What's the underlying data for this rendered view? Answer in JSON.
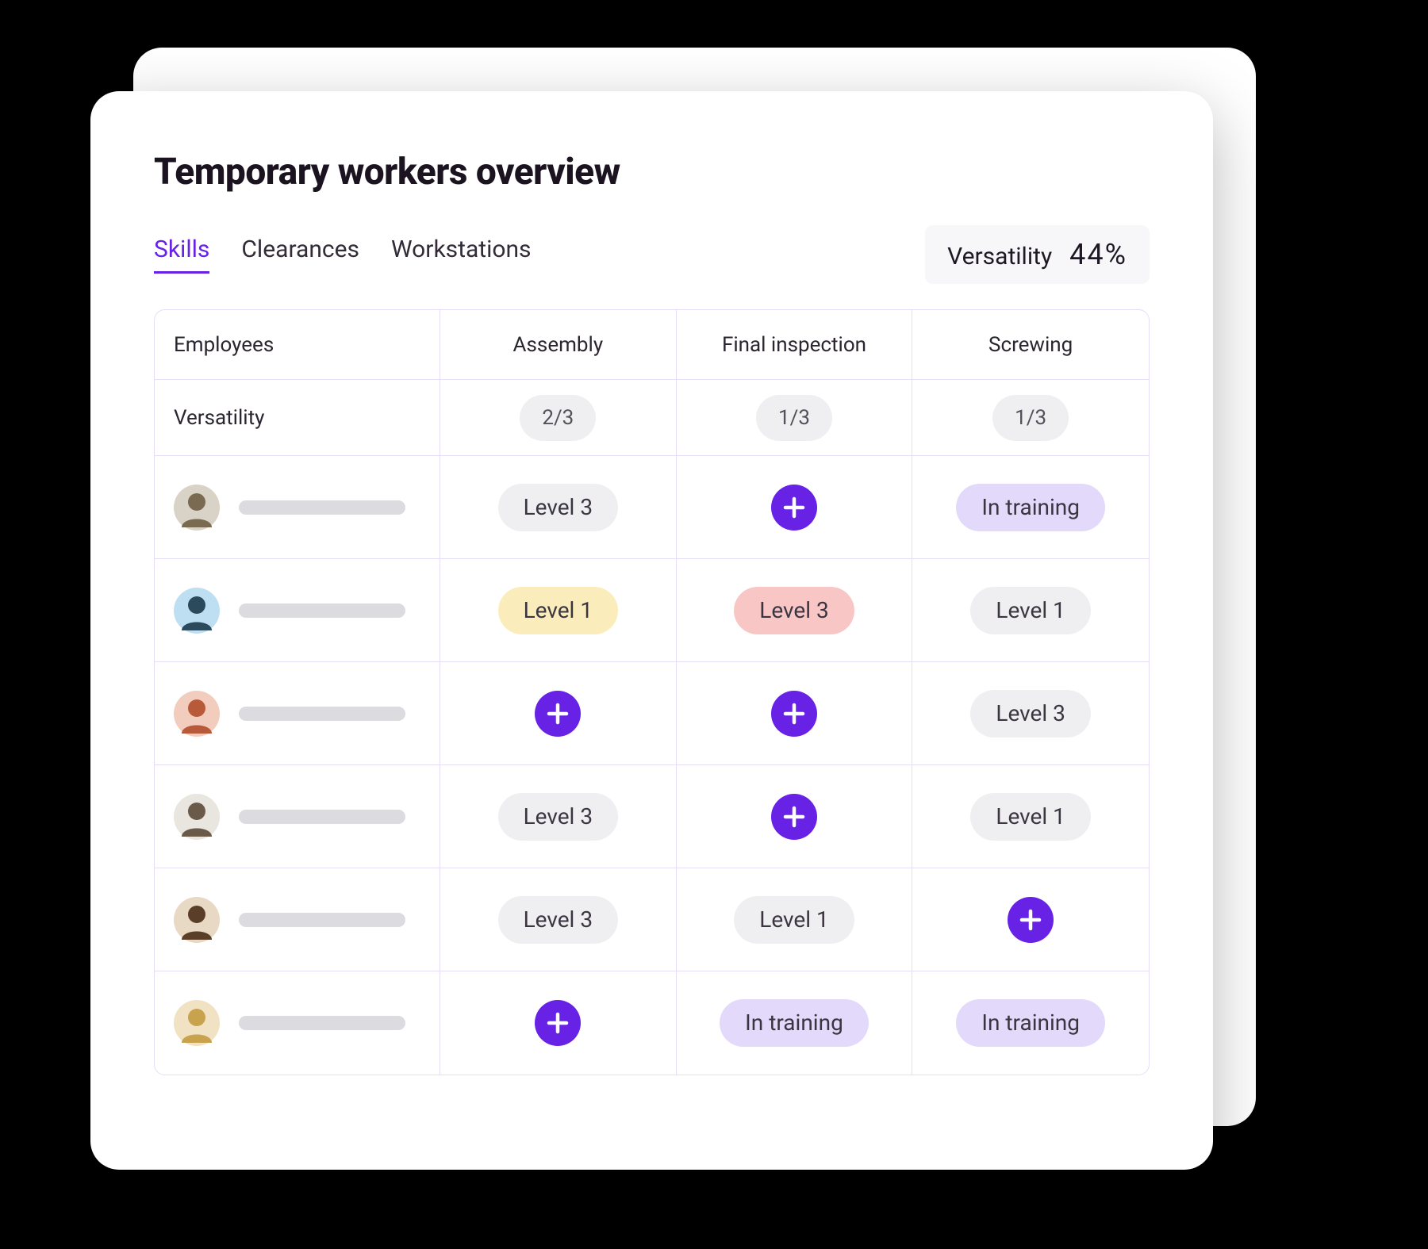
{
  "title": "Temporary workers overview",
  "tabs": [
    "Skills",
    "Clearances",
    "Workstations"
  ],
  "active_tab": 0,
  "versatility": {
    "label": "Versatility",
    "value": "44%"
  },
  "columns": [
    "Employees",
    "Assembly",
    "Final inspection",
    "Screwing"
  ],
  "versatility_row": {
    "label": "Versatility",
    "counts": [
      "2/3",
      "1/3",
      "1/3"
    ]
  },
  "avatar_colors": [
    {
      "bg": "#d9d2c6",
      "fg": "#7a6a52"
    },
    {
      "bg": "#bedff2",
      "fg": "#2b4b5c"
    },
    {
      "bg": "#f2cdbd",
      "fg": "#b85a3a"
    },
    {
      "bg": "#e9e5df",
      "fg": "#6a5a4a"
    },
    {
      "bg": "#e8d9c5",
      "fg": "#5a3e28"
    },
    {
      "bg": "#f1e2c3",
      "fg": "#c9a24e"
    }
  ],
  "rows": [
    {
      "cells": [
        {
          "type": "pill",
          "text": "Level 3",
          "variant": "gray"
        },
        {
          "type": "plus"
        },
        {
          "type": "pill",
          "text": "In training",
          "variant": "lavender"
        }
      ]
    },
    {
      "cells": [
        {
          "type": "pill",
          "text": "Level 1",
          "variant": "yellow"
        },
        {
          "type": "pill",
          "text": "Level 3",
          "variant": "red"
        },
        {
          "type": "pill",
          "text": "Level 1",
          "variant": "gray"
        }
      ]
    },
    {
      "cells": [
        {
          "type": "plus"
        },
        {
          "type": "plus"
        },
        {
          "type": "pill",
          "text": "Level 3",
          "variant": "gray"
        }
      ]
    },
    {
      "cells": [
        {
          "type": "pill",
          "text": "Level 3",
          "variant": "gray"
        },
        {
          "type": "plus"
        },
        {
          "type": "pill",
          "text": "Level 1",
          "variant": "gray"
        }
      ]
    },
    {
      "cells": [
        {
          "type": "pill",
          "text": "Level 3",
          "variant": "gray"
        },
        {
          "type": "pill",
          "text": "Level 1",
          "variant": "gray"
        },
        {
          "type": "plus"
        }
      ]
    },
    {
      "cells": [
        {
          "type": "plus"
        },
        {
          "type": "pill",
          "text": "In training",
          "variant": "lavender"
        },
        {
          "type": "pill",
          "text": "In training",
          "variant": "lavender"
        }
      ]
    }
  ]
}
